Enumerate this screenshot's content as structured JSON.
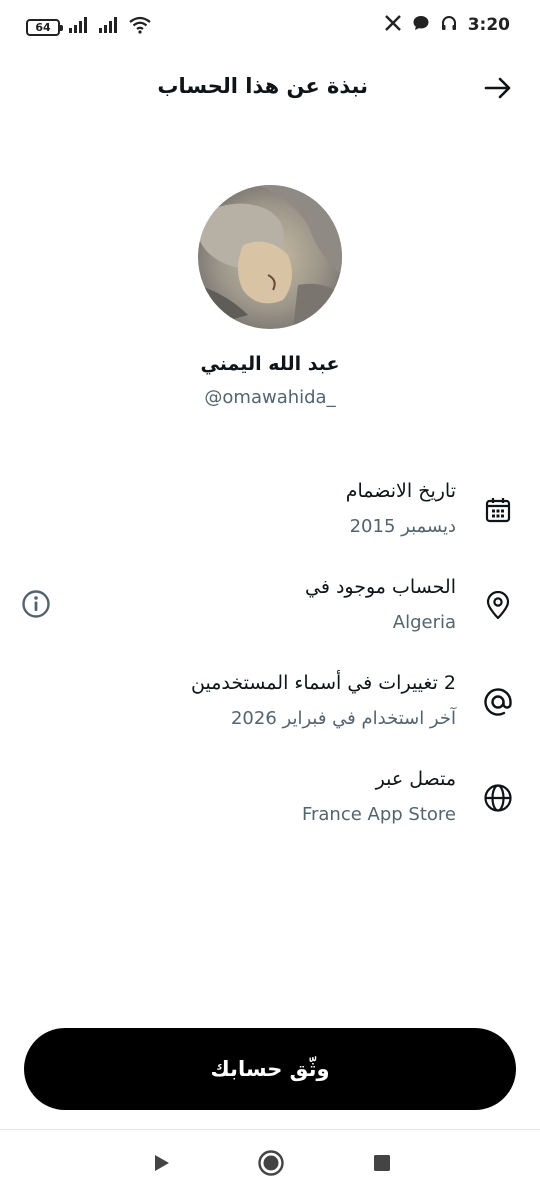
{
  "status_bar": {
    "battery": "64",
    "time": "3:20",
    "icons": [
      "signal-icon",
      "signal-icon",
      "wifi-icon",
      "x-logo-icon",
      "chat-bubble-icon",
      "headphones-icon"
    ]
  },
  "header": {
    "title": "نبذة عن هذا الحساب",
    "back_icon": "arrow-right-icon"
  },
  "profile": {
    "display_name": "عبد الله اليمني",
    "handle": "@omawahida_"
  },
  "info_rows": [
    {
      "icon": "calendar-icon",
      "title": "تاريخ الانضمام",
      "subtitle": "ديسمبر 2015"
    },
    {
      "icon": "location-pin-icon",
      "title": "الحساب موجود في",
      "subtitle": "Algeria",
      "has_info_button": true
    },
    {
      "icon": "at-sign-icon",
      "title": "2 تغييرات في أسماء المستخدمين",
      "subtitle": "آخر استخدام في فبراير 2026"
    },
    {
      "icon": "globe-icon",
      "title": "متصل عبر",
      "subtitle": "France App Store"
    }
  ],
  "verify_button": {
    "label": "وثّق حسابك"
  },
  "nav_bar": {
    "icons": [
      "back-triangle-icon",
      "home-circle-icon",
      "recents-square-icon"
    ]
  },
  "colors": {
    "text_primary": "#0f1419",
    "text_secondary": "#536471",
    "button_bg": "#000000",
    "button_text": "#ffffff",
    "background": "#ffffff"
  }
}
